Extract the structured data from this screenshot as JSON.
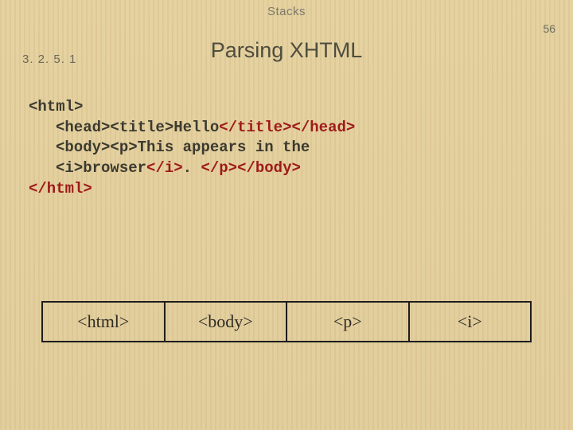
{
  "header": {
    "label": "Stacks"
  },
  "page_number": "56",
  "section_number": "3. 2. 5. 1",
  "title": "Parsing XHTML",
  "code": {
    "l1_open": "<html>",
    "l2_a": "<head><title>",
    "l2_b": "Hello",
    "l2_c": "</title></head>",
    "l3_a": "<body><p>",
    "l3_b": "This appears in the",
    "l4_a": "<i>",
    "l4_b": "browser",
    "l4_c": "</i>",
    "l4_d": ". ",
    "l4_e": "</p></body>",
    "l5_close": "</html>"
  },
  "stack": {
    "cells": [
      "<html>",
      "<body>",
      "<p>",
      "<i>"
    ]
  }
}
